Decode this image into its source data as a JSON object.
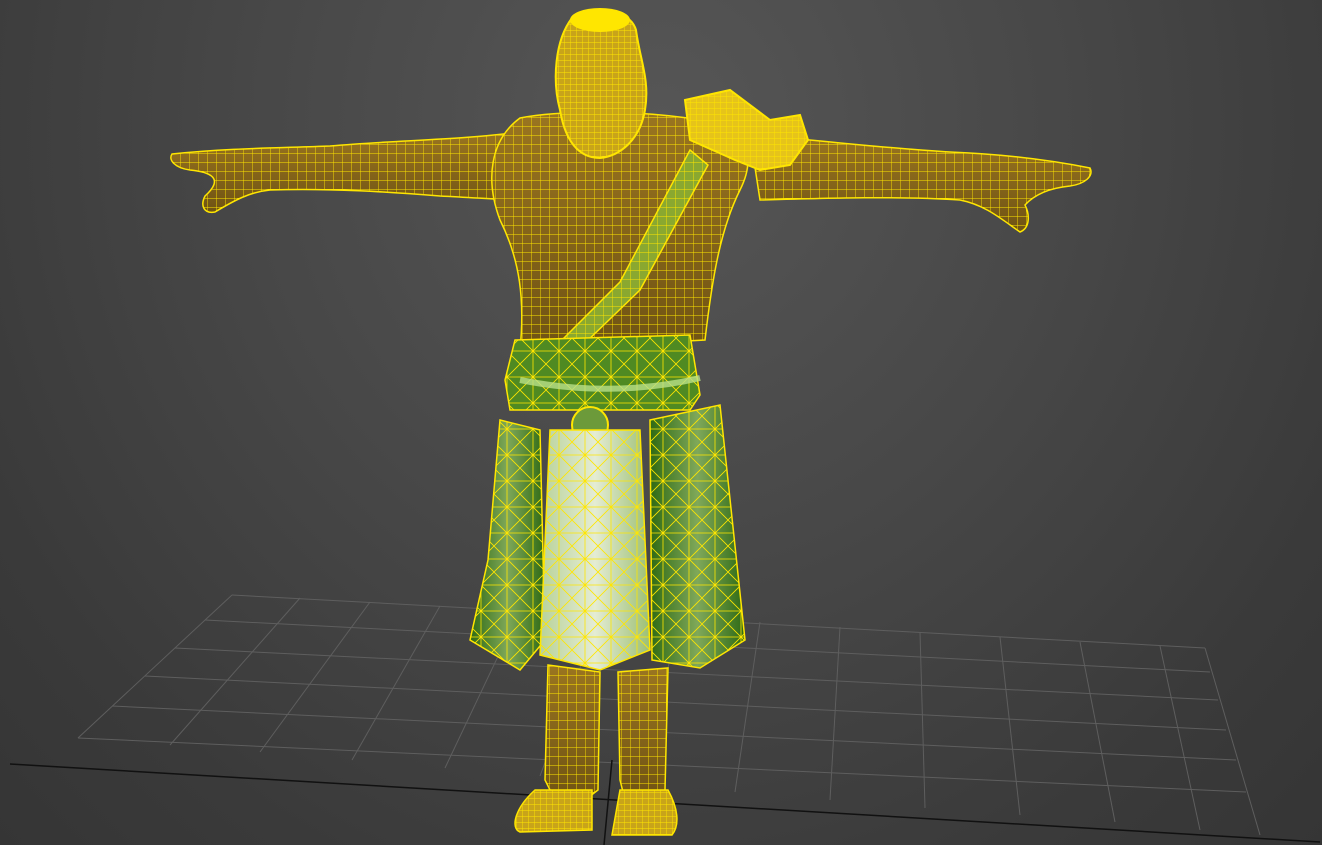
{
  "viewport": {
    "background_color": "#474747",
    "grid_color": "#5e5e5e",
    "axis_color": "#111111",
    "wireframe_color": "#ffe600",
    "skin_fill_color": "#8a6a1c",
    "cloth_fill_color": "#3f7a1e",
    "cloth_highlight_color": "#b9d48a",
    "selected_object": "character-mesh",
    "display_mode": "shaded-with-wireframe"
  }
}
